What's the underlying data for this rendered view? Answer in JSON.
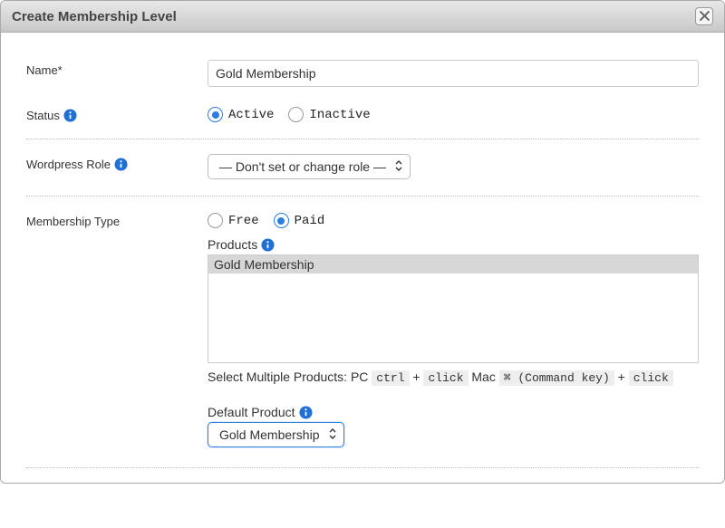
{
  "dialog": {
    "title": "Create Membership Level"
  },
  "labels": {
    "name": "Name*",
    "status": "Status",
    "wordpress_role": "Wordpress Role",
    "membership_type": "Membership Type",
    "products": "Products",
    "default_product": "Default Product"
  },
  "fields": {
    "name_value": "Gold Membership",
    "status": {
      "options": {
        "active": "Active",
        "inactive": "Inactive"
      },
      "selected": "active"
    },
    "wordpress_role": {
      "selected_label": "— Don't set or change role —"
    },
    "membership_type": {
      "options": {
        "free": "Free",
        "paid": "Paid"
      },
      "selected": "paid"
    },
    "products": {
      "items": [
        "Gold Membership"
      ],
      "selected_index": 0
    },
    "default_product": {
      "selected_label": "Gold Membership"
    }
  },
  "hint": {
    "prefix": "Select Multiple Products: PC",
    "kbd1": "ctrl",
    "plus": " + ",
    "kbd2": "click",
    "mac": " Mac ",
    "kbd3": "⌘ (Command key)",
    "kbd4": "click"
  }
}
